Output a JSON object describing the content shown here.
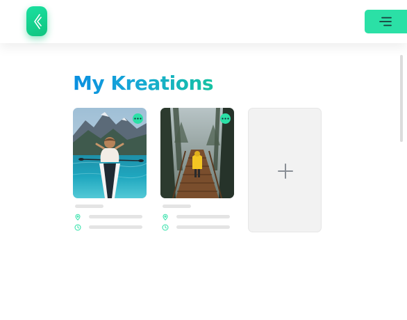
{
  "header": {
    "logo_icon": "back-chevrons-icon",
    "menu_icon": "hamburger-menu-icon",
    "accent_color": "#2be0a6"
  },
  "page": {
    "title": "My Kreations"
  },
  "kreations": [
    {
      "photo": "woman-kayaking-on-mountain-lake",
      "menu_icon": "more-dots-icon",
      "location_icon": "map-pin-icon",
      "time_icon": "clock-icon"
    },
    {
      "photo": "hiker-in-yellow-jacket-on-forest-boardwalk",
      "menu_icon": "more-dots-icon",
      "location_icon": "map-pin-icon",
      "time_icon": "clock-icon"
    }
  ],
  "add_card": {
    "icon": "plus-icon"
  }
}
